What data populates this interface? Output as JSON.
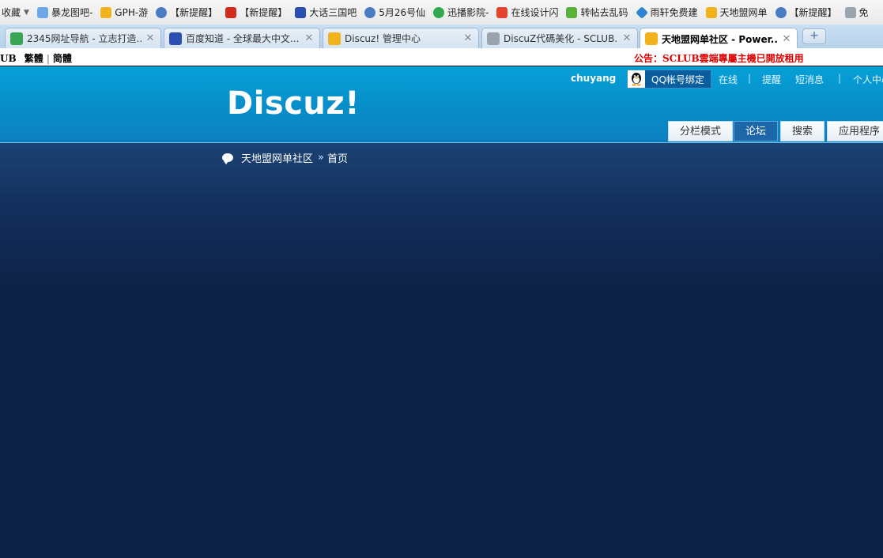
{
  "bookmarks": [
    {
      "label": "收藏",
      "icon": "star-icon",
      "color": "#f0c030"
    },
    {
      "label": "暴龙图吧-",
      "icon": "dragon-icon",
      "color": "#6aa8e8"
    },
    {
      "label": "GPH-游",
      "icon": "trophy-icon",
      "color": "#f2b21c"
    },
    {
      "label": "【新提醒】",
      "icon": "globe-icon",
      "color": "#4a7cc0"
    },
    {
      "label": "【新提醒】",
      "icon": "seal-icon",
      "color": "#d22b1e"
    },
    {
      "label": "大话三国吧",
      "icon": "paw-icon",
      "color": "#2b4fb0"
    },
    {
      "label": "5月26号仙",
      "icon": "globe-icon",
      "color": "#4a7cc0"
    },
    {
      "label": "迅播影院-",
      "icon": "play-icon",
      "color": "#2fa84f"
    },
    {
      "label": "在线设计闪",
      "icon": "grid-icon",
      "color": "#e4432c"
    },
    {
      "label": "转帖去乱码",
      "icon": "leaf-icon",
      "color": "#58b23b"
    },
    {
      "label": "雨轩免费建",
      "icon": "diamond-icon",
      "color": "#2b84d0"
    },
    {
      "label": "天地盟网单",
      "icon": "trophy-icon",
      "color": "#f2b21c"
    },
    {
      "label": "【新提醒】",
      "icon": "globe-icon",
      "color": "#4a7cc0"
    },
    {
      "label": "免",
      "icon": "page-icon",
      "color": "#9aa4ae"
    }
  ],
  "tabs": [
    {
      "title": "2345网址导航 - 立志打造...",
      "icon": "nav2345-icon",
      "color": "#3aa655",
      "active": false
    },
    {
      "title": "百度知道 - 全球最大中文...",
      "icon": "paw-icon",
      "color": "#2b4fb0",
      "active": false
    },
    {
      "title": "Discuz! 管理中心",
      "icon": "trophy-icon",
      "color": "#f2b21c",
      "active": false
    },
    {
      "title": "DiscuZ代碼美化 - SCLUB...",
      "icon": "page-icon",
      "color": "#9aa4ae",
      "active": false
    },
    {
      "title": "天地盟网单社区 - Power...",
      "icon": "trophy-icon",
      "color": "#f2b21c",
      "active": true
    }
  ],
  "new_tab_label": "+",
  "strip": {
    "lang_left": "UB",
    "lang_trad": "繁體",
    "lang_simp": "简體",
    "notice": "公告：SCLUB雲端專屬主機已開放租用"
  },
  "header": {
    "logo": "Discuz!",
    "username": "chuyang",
    "qq_bind": "QQ帐号绑定",
    "links": [
      "在线",
      "提醒",
      "短消息",
      "个人中心"
    ],
    "nav": [
      "分栏模式",
      "论坛",
      "搜索",
      "应用程序"
    ],
    "active_nav": "论坛"
  },
  "breadcrumb": {
    "site": "天地盟网单社区",
    "separator": "»",
    "current": "首页"
  },
  "colors": {
    "header_top": "#05a0d6",
    "header_bottom": "#0b7fbf",
    "body_bg": "#0f2348",
    "notice": "#dd0000"
  }
}
